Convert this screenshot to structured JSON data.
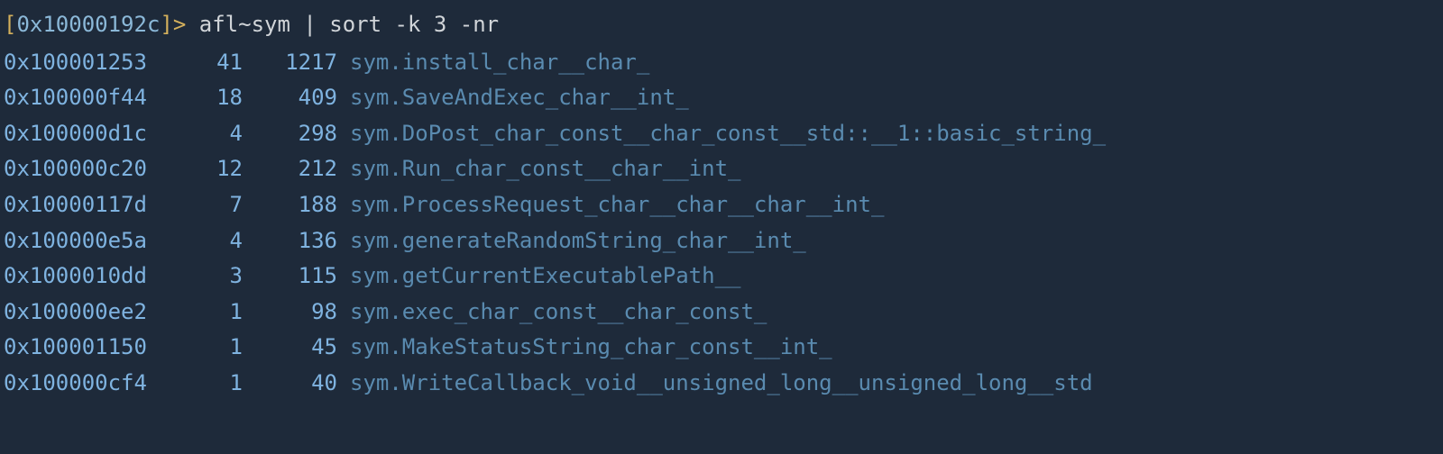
{
  "prompt": {
    "open_bracket": "[",
    "address": "0x10000192c",
    "close_bracket": "]",
    "gt": ">",
    "command": "afl~sym | sort -k 3 -nr"
  },
  "rows": [
    {
      "addr": "0x100001253",
      "n1": "41",
      "n2": "1217",
      "sym": "sym.install_char__char_"
    },
    {
      "addr": "0x100000f44",
      "n1": "18",
      "n2": "409",
      "sym": "sym.SaveAndExec_char__int_"
    },
    {
      "addr": "0x100000d1c",
      "n1": "4",
      "n2": "298",
      "sym": "sym.DoPost_char_const__char_const__std::__1::basic_string_"
    },
    {
      "addr": "0x100000c20",
      "n1": "12",
      "n2": "212",
      "sym": "sym.Run_char_const__char__int_"
    },
    {
      "addr": "0x10000117d",
      "n1": "7",
      "n2": "188",
      "sym": "sym.ProcessRequest_char__char__char__int_"
    },
    {
      "addr": "0x100000e5a",
      "n1": "4",
      "n2": "136",
      "sym": "sym.generateRandomString_char__int_"
    },
    {
      "addr": "0x1000010dd",
      "n1": "3",
      "n2": "115",
      "sym": "sym.getCurrentExecutablePath__"
    },
    {
      "addr": "0x100000ee2",
      "n1": "1",
      "n2": "98",
      "sym": "sym.exec_char_const__char_const_"
    },
    {
      "addr": "0x100001150",
      "n1": "1",
      "n2": "45",
      "sym": "sym.MakeStatusString_char_const__int_"
    },
    {
      "addr": "0x100000cf4",
      "n1": "1",
      "n2": "40",
      "sym": "sym.WriteCallback_void__unsigned_long__unsigned_long__std"
    }
  ]
}
